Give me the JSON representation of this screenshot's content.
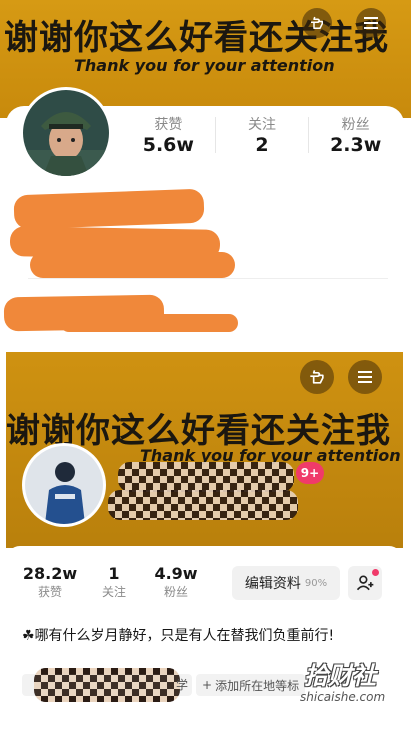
{
  "panel1": {
    "banner_title": "谢谢你这么好看还关注我",
    "banner_subtitle": "Thank you for your attention",
    "stats": [
      {
        "label": "获赞",
        "value": "5.6w"
      },
      {
        "label": "关注",
        "value": "2"
      },
      {
        "label": "粉丝",
        "value": "2.3w"
      }
    ]
  },
  "panel2": {
    "banner_title": "谢谢你这么好看还关注我",
    "banner_subtitle": "Thank you for your attention",
    "badge": "9+",
    "stats": [
      {
        "value": "28.2w",
        "label": "获赞"
      },
      {
        "value": "1",
        "label": "关注"
      },
      {
        "value": "4.9w",
        "label": "粉丝"
      }
    ],
    "edit_button": "编辑资料",
    "edit_percent": "90%",
    "bio_icon": "☘",
    "bio": "哪有什么岁月静好，只是有人在替我们负重前行!",
    "tag_fragment": "学",
    "add_location": "添加所在地等标"
  },
  "watermark": {
    "text": "拾财社",
    "url": "shicaishe.com"
  },
  "colors": {
    "banner": "#c88a0c",
    "blur": "#f0883a",
    "badge": "#f03a6a"
  },
  "icons": [
    "hand-point-icon",
    "menu-icon",
    "add-friend-icon",
    "avatar-soldier",
    "avatar-person"
  ]
}
